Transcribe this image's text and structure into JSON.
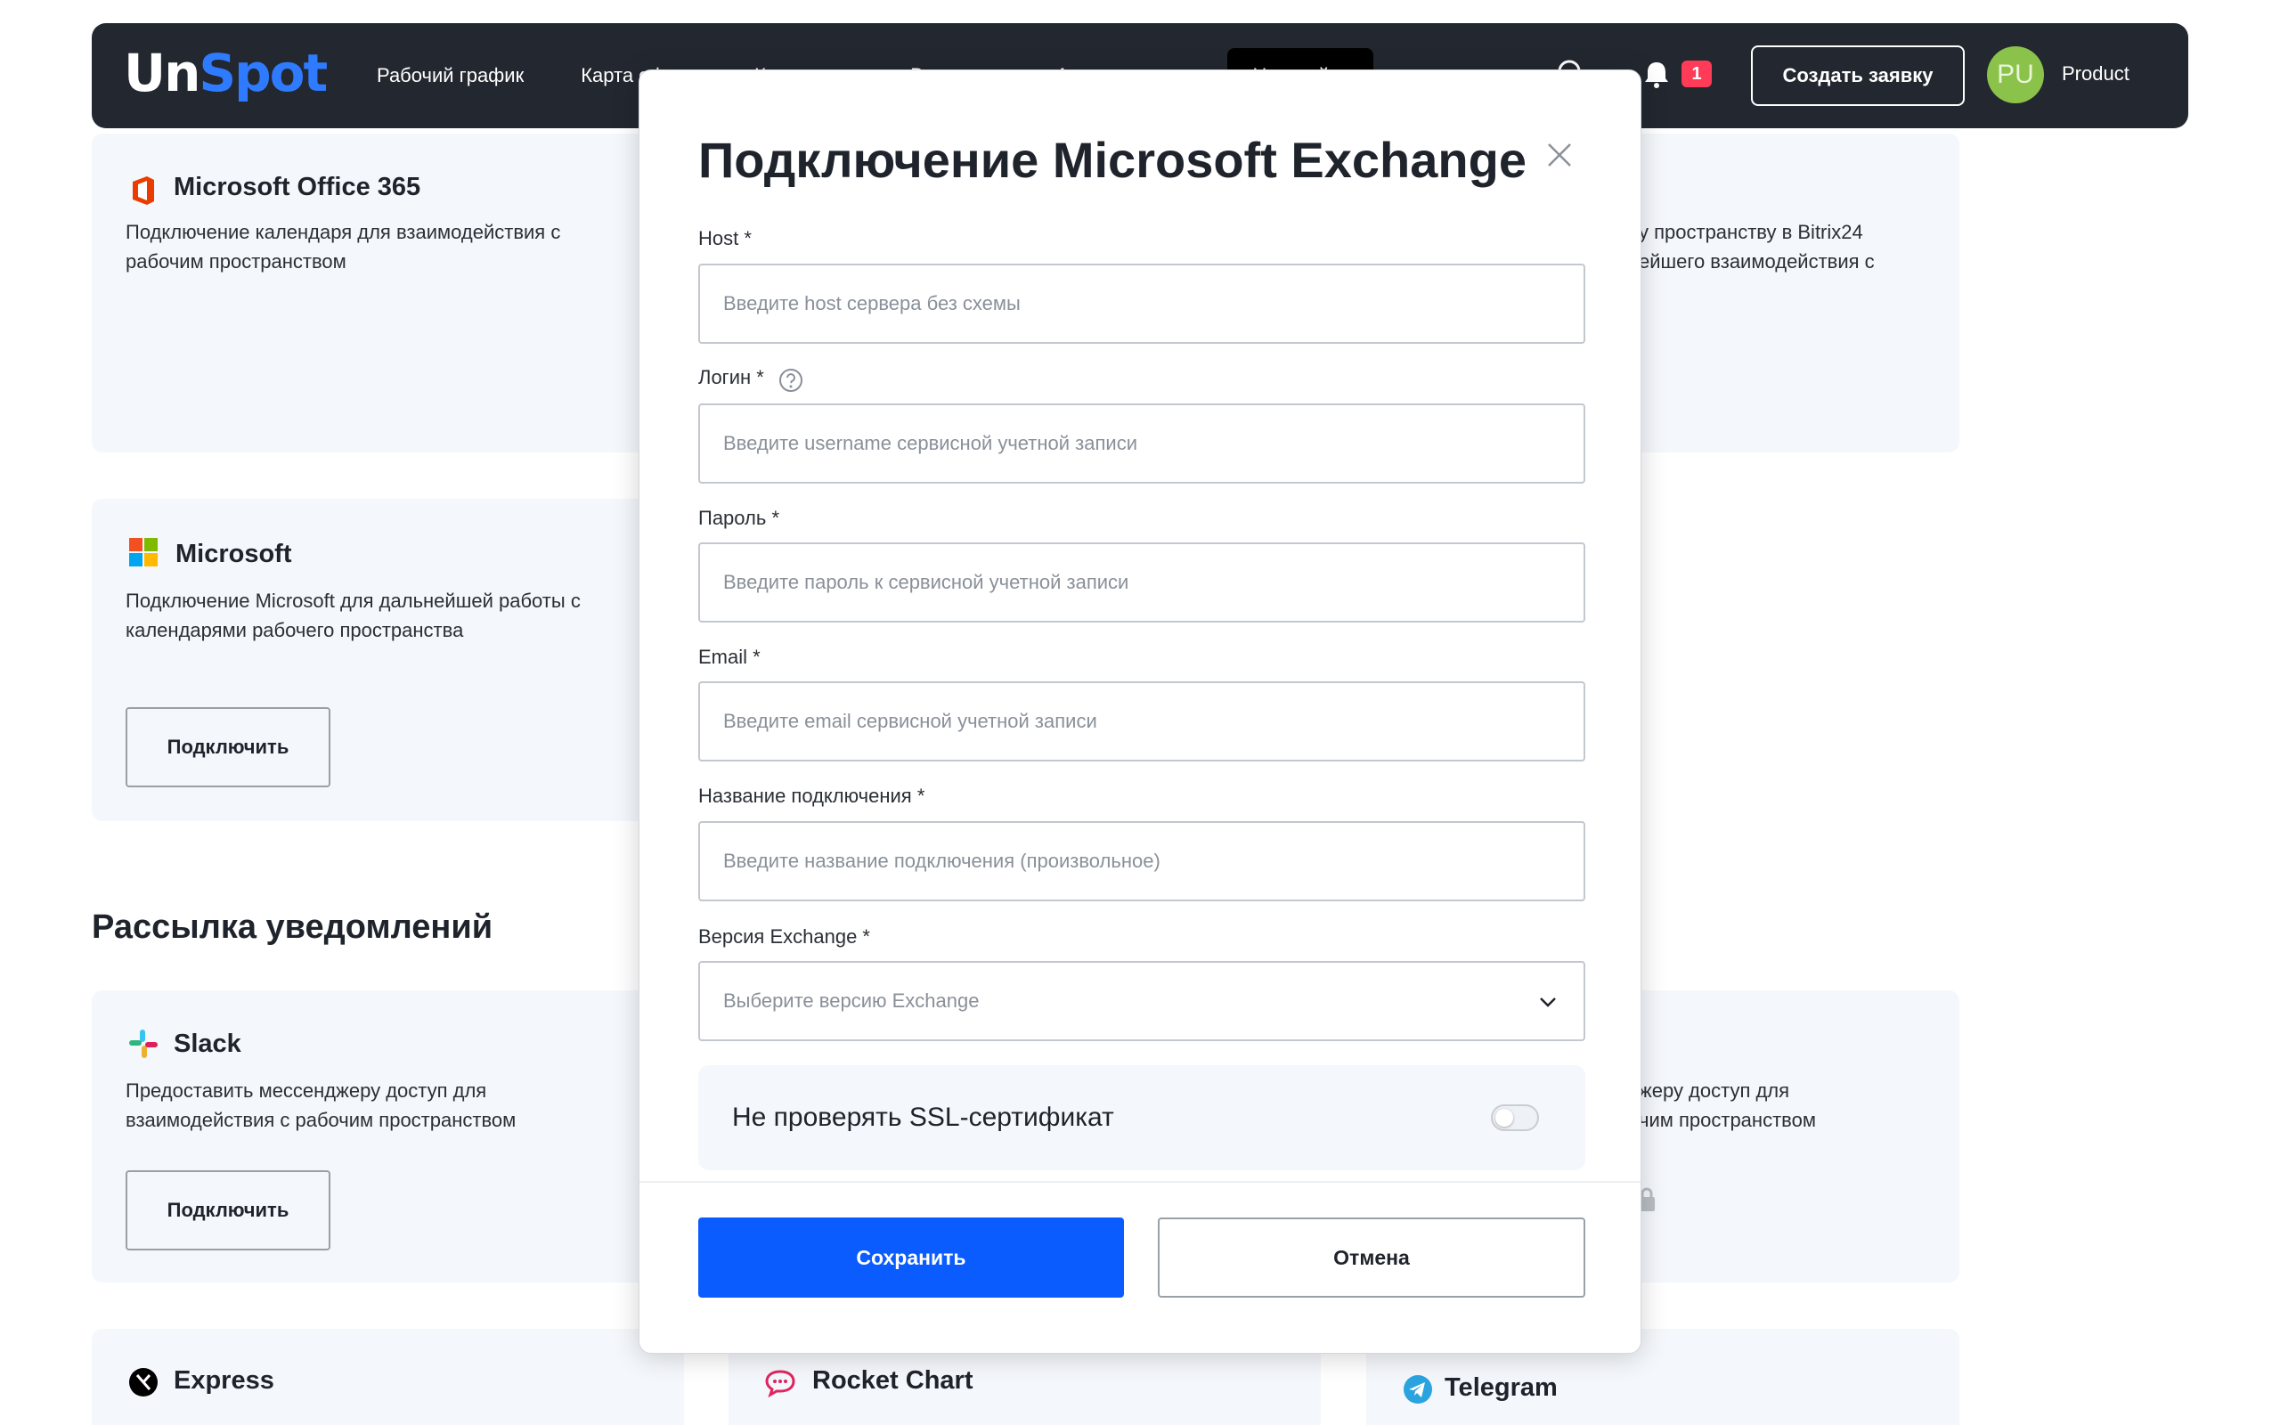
{
  "header": {
    "logo_un": "Un",
    "logo_spot": "Spot",
    "nav": [
      "Рабочий график",
      "Карта офиса",
      "Календарь",
      "Визиторы",
      "Аналитика"
    ],
    "nav_active": "Настройки",
    "notification_count": "1",
    "create_button": "Создать заявку",
    "avatar_initials": "PU",
    "user_name": "Product"
  },
  "cards": {
    "office365": {
      "title": "Microsoft Office 365",
      "desc": "Подключение календаря для взаимодействия с рабочим пространством"
    },
    "bitrix": {
      "desc_line1": "у пространству в Bitrix24",
      "desc_line2": "ейшего взаимодействия с"
    },
    "microsoft": {
      "title": "Microsoft",
      "desc": "Подключение Microsoft для дальнейшей работы с календарями рабочего пространства",
      "button": "Подключить"
    },
    "slack": {
      "title": "Slack",
      "desc": "Предоставить мессенджеру доступ для взаимодействия с рабочим пространством",
      "button": "Подключить"
    },
    "right_notify": {
      "desc_line1": "жеру доступ для",
      "desc_line2": "чим пространством"
    },
    "express": {
      "title": "Express"
    },
    "rocket": {
      "title": "Rocket Chart"
    },
    "telegram": {
      "title": "Telegram"
    }
  },
  "sections": {
    "notifications": "Рассылка уведомлений"
  },
  "modal": {
    "title": "Подключение Microsoft Exchange",
    "host_label": "Host *",
    "host_placeholder": "Введите host сервера без схемы",
    "login_label": "Логин *",
    "login_placeholder": "Введите username сервисной учетной записи",
    "password_label": "Пароль *",
    "password_placeholder": "Введите пароль к сервисной учетной записи",
    "email_label": "Email *",
    "email_placeholder": "Введите email сервисной учетной записи",
    "name_label": "Название подключения *",
    "name_placeholder": "Введите название подключения (произвольное)",
    "version_label": "Версия Exchange *",
    "version_placeholder": "Выберите версию Exchange",
    "ssl_label": "Не проверять SSL-сертификат",
    "ssl_enabled": false,
    "save_button": "Сохранить",
    "cancel_button": "Отмена"
  },
  "colors": {
    "header_bg": "#23272f",
    "accent_blue": "#0a5cff",
    "logo_blue": "#2f7bff",
    "badge_red": "#ff3b57",
    "avatar_green": "#8bc34a",
    "card_bg": "#f4f7fb"
  }
}
